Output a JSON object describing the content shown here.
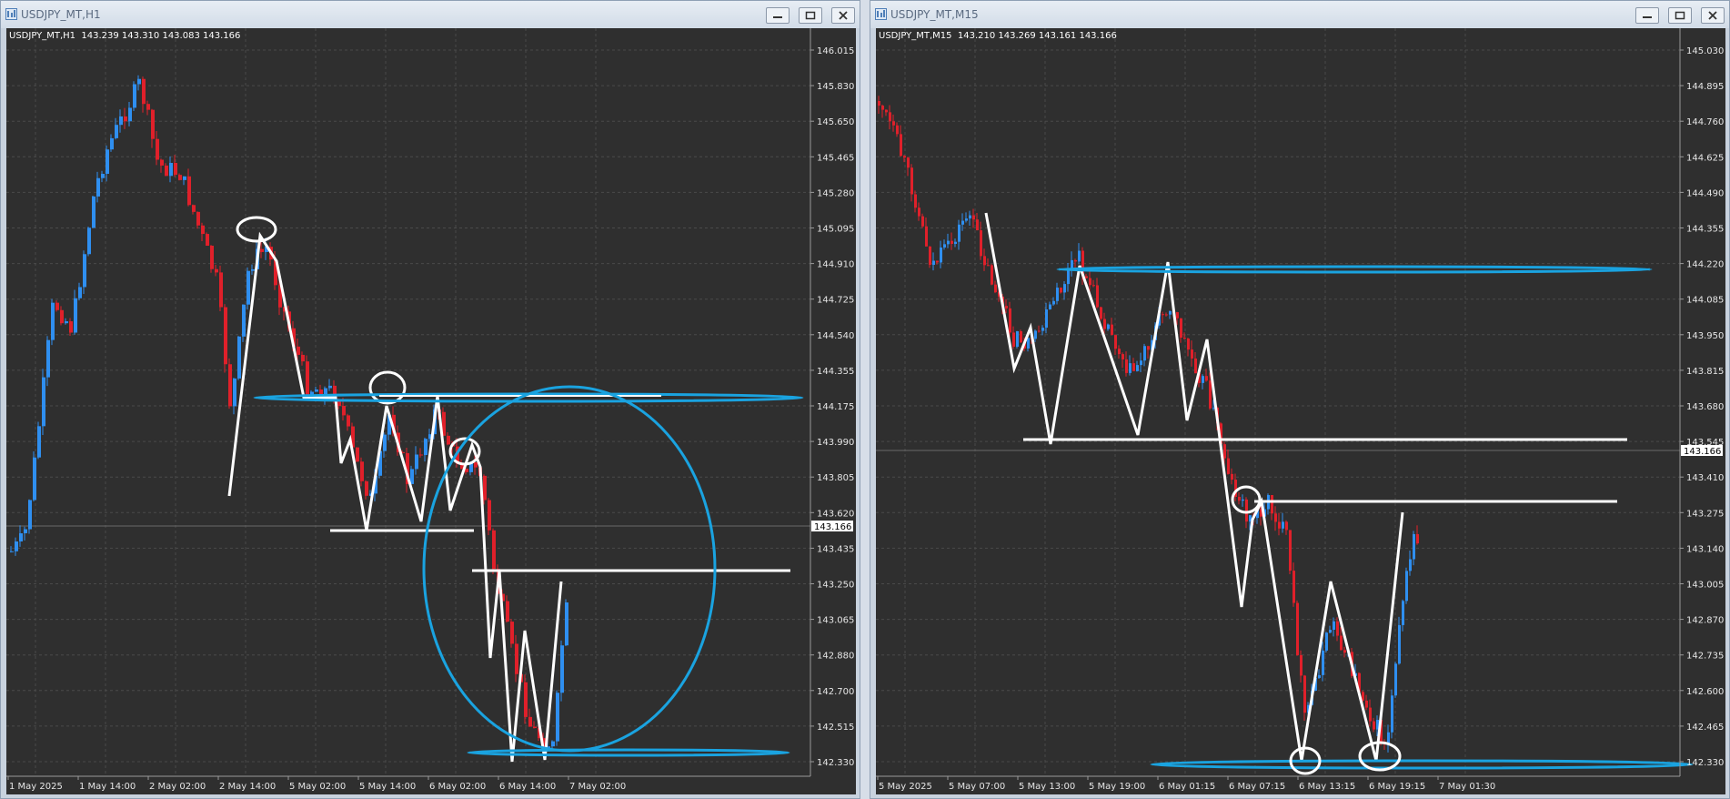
{
  "windows": [
    {
      "id": "left",
      "title": "USDJPY_MT,H1",
      "symbol_line": "USDJPY_MT,H1  143.239 143.310 143.083 143.166",
      "current_price": "143.166",
      "price_axis": [
        "146.015",
        "145.830",
        "145.650",
        "145.465",
        "145.280",
        "145.095",
        "144.910",
        "144.725",
        "144.540",
        "144.355",
        "144.175",
        "143.990",
        "143.805",
        "143.620",
        "143.435",
        "143.250",
        "143.065",
        "142.880",
        "142.700",
        "142.515",
        "142.330"
      ],
      "time_axis": [
        "1 May 2025",
        "1 May 14:00",
        "2 May 02:00",
        "2 May 14:00",
        "5 May 02:00",
        "5 May 14:00",
        "6 May 02:00",
        "6 May 14:00",
        "7 May 02:00"
      ]
    },
    {
      "id": "right",
      "title": "USDJPY_MT,M15",
      "symbol_line": "USDJPY_MT,M15  143.210 143.269 143.161 143.166",
      "current_price": "143.166",
      "price_axis": [
        "145.030",
        "144.895",
        "144.760",
        "144.625",
        "144.490",
        "144.355",
        "144.220",
        "144.085",
        "143.950",
        "143.815",
        "143.680",
        "143.545",
        "143.410",
        "143.275",
        "143.140",
        "143.005",
        "142.870",
        "142.735",
        "142.600",
        "142.465",
        "142.330"
      ],
      "time_axis": [
        "5 May 2025",
        "5 May 07:00",
        "5 May 13:00",
        "5 May 19:00",
        "6 May 01:15",
        "6 May 07:15",
        "6 May 13:15",
        "6 May 19:15",
        "7 May 01:30"
      ]
    }
  ],
  "colors": {
    "background": "#2f2f2f",
    "bull_candle": "#2f8ff0",
    "bear_candle": "#e0202a",
    "annotation_white": "#ffffff",
    "annotation_blue": "#1aa3e0",
    "grid": "#555555"
  },
  "icons": [
    "chart-window-icon",
    "minimize-icon",
    "maximize-icon",
    "close-icon"
  ]
}
